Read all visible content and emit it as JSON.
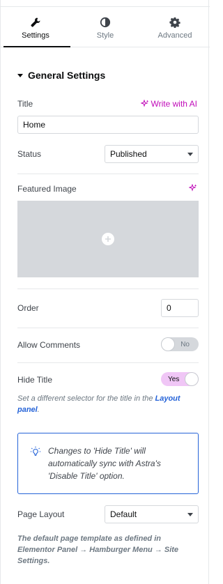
{
  "tabs": [
    {
      "label": "Settings",
      "icon": "wrench-icon",
      "active": true
    },
    {
      "label": "Style",
      "icon": "half-circle-icon",
      "active": false
    },
    {
      "label": "Advanced",
      "icon": "gear-icon",
      "active": false
    }
  ],
  "section": {
    "title": "General Settings"
  },
  "title_field": {
    "label": "Title",
    "ai_link": "Write with AI",
    "value": "Home"
  },
  "status_field": {
    "label": "Status",
    "value": "Published"
  },
  "featured_image": {
    "label": "Featured Image"
  },
  "order_field": {
    "label": "Order",
    "value": "0"
  },
  "allow_comments": {
    "label": "Allow Comments",
    "state": "No"
  },
  "hide_title": {
    "label": "Hide Title",
    "state": "Yes",
    "desc_prefix": "Set a different selector for the title in the ",
    "desc_link": "Layout panel",
    "desc_suffix": "."
  },
  "notice": {
    "text": "Changes to 'Hide Title' will automatically sync with Astra's 'Disable Title' option."
  },
  "page_layout": {
    "label": "Page Layout",
    "value": "Default",
    "desc": "The default page template as defined in Elementor Panel → Hamburger Menu → Site Settings."
  },
  "colors": {
    "accent_ai": "#c00bb9",
    "link": "#2563d8",
    "toggle_on": "#f0c6f6"
  }
}
